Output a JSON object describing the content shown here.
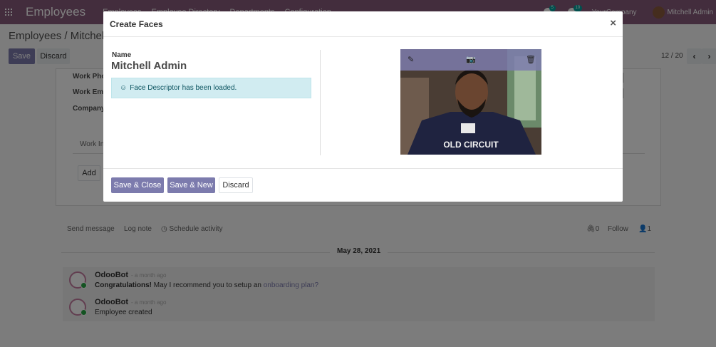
{
  "navbar": {
    "app_title": "Employees",
    "menu": [
      "Employees",
      "Employee Directory",
      "Departments",
      "Configuration"
    ],
    "messages_count": "5",
    "activities_count": "10",
    "company": "YourCompany",
    "user": "Mitchell Admin"
  },
  "control_panel": {
    "breadcrumb": "Employees / Mitchell A",
    "save_label": "Save",
    "discard_label": "Discard",
    "pager": "12 / 20",
    "prev_icon": "chevron-left-icon",
    "next_icon": "chevron-right-icon"
  },
  "form": {
    "labels": [
      "Work Pho",
      "Work Em",
      "Company"
    ],
    "tab_label": "Work In",
    "add_label": "Add"
  },
  "chatter": {
    "send_message": "Send message",
    "log_note": "Log note",
    "schedule_activity": "Schedule activity",
    "attachments_count": "0",
    "follow": "Follow",
    "followers_count": "1",
    "date_separator": "May 28, 2021",
    "messages": [
      {
        "author": "OdooBot",
        "time": "- a month ago",
        "bold": "Congratulations!",
        "text": " May I recommend you to setup an ",
        "link": "onboarding plan?"
      },
      {
        "author": "OdooBot",
        "time": "- a month ago",
        "text": "Employee created"
      }
    ]
  },
  "modal": {
    "title": "Create Faces",
    "close_symbol": "×",
    "name_label": "Name",
    "name_value": "Mitchell Admin",
    "alert_icon": "☺",
    "alert_text": "Face Descriptor has been loaded.",
    "photo_shirt_text": "OLD CIRCUIT",
    "photo_tools": [
      "pencil-icon",
      "camera-icon",
      "trash-icon"
    ],
    "save_close_label": "Save & Close",
    "save_new_label": "Save & New",
    "discard_label": "Discard"
  },
  "colors": {
    "brand": "#875a7b",
    "primary_button": "#7c7bad",
    "alert_bg": "#d1ecf1"
  }
}
